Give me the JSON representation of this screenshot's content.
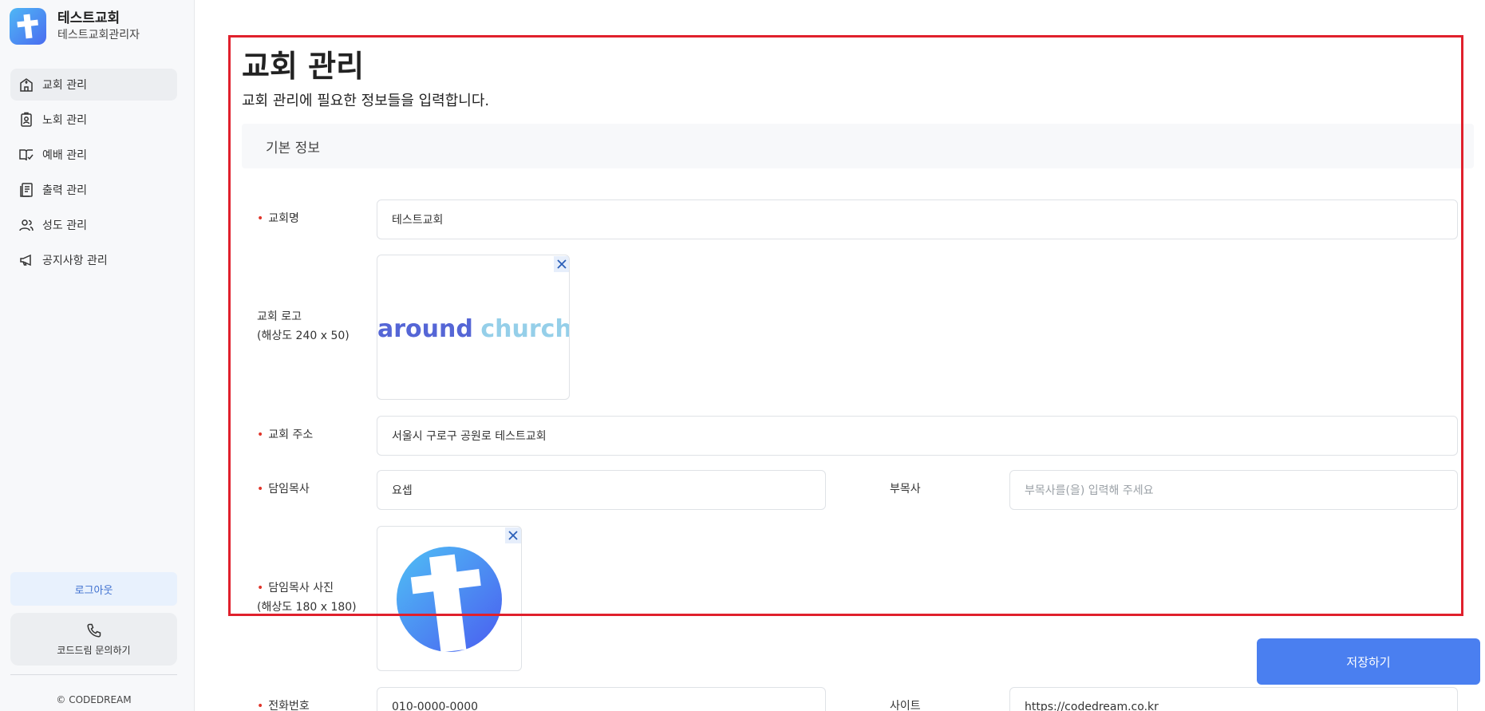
{
  "sidebar": {
    "church_name": "테스트교회",
    "admin_name": "테스트교회관리자",
    "items": [
      {
        "label": "교회 관리",
        "icon": "church-building-icon",
        "active": true
      },
      {
        "label": "노회 관리",
        "icon": "id-badge-icon",
        "active": false
      },
      {
        "label": "예배 관리",
        "icon": "book-check-icon",
        "active": false
      },
      {
        "label": "출력 관리",
        "icon": "document-icon",
        "active": false
      },
      {
        "label": "성도 관리",
        "icon": "users-icon",
        "active": false
      },
      {
        "label": "공지사항 관리",
        "icon": "megaphone-icon",
        "active": false
      }
    ],
    "logout_label": "로그아웃",
    "inquiry_label": "코드드림 문의하기",
    "copyright": "© CODEDREAM"
  },
  "main": {
    "title": "교회 관리",
    "description": "교회 관리에 필요한 정보들을 입력합니다.",
    "section_title": "기본 정보",
    "form": {
      "church_name_label": "교회명",
      "church_name_value": "테스트교회",
      "logo_label_line1": "교회 로고",
      "logo_label_line2": "(해상도 240 x 50)",
      "logo_text_part1": "around",
      "logo_text_part2": "church",
      "address_label": "교회 주소",
      "address_value": "서울시 구로구 공원로 테스트교회",
      "pastor_label": "담임목사",
      "pastor_value": "요셉",
      "assoc_pastor_label": "부목사",
      "assoc_pastor_placeholder": "부목사를(을) 입력해 주세요",
      "pastor_photo_label_line1": "담임목사 사진",
      "pastor_photo_label_line2": "(해상도 180 x 180)",
      "phone_label": "전화번호",
      "phone_value": "010-0000-0000",
      "site_label": "사이트",
      "site_value": "https://codedream.co.kr"
    },
    "save_label": "저장하기"
  },
  "colors": {
    "accent": "#4a7ff0",
    "required": "#e0362b",
    "highlight": "#e0202c"
  }
}
